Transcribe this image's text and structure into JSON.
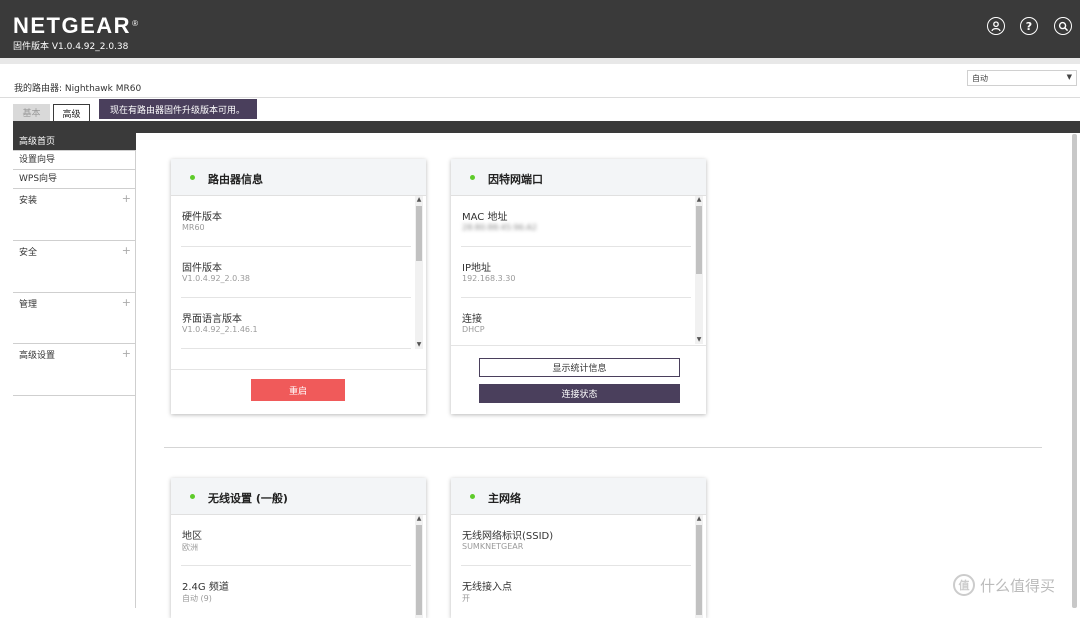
{
  "header": {
    "brand": "NETGEAR",
    "brand_mark": "®",
    "firmware_version": "固件版本 V1.0.4.92_2.0.38",
    "icons": [
      "account-icon",
      "help-icon",
      "search-icon"
    ]
  },
  "top": {
    "my_router": "我的路由器: Nighthawk MR60",
    "language_select": "自动"
  },
  "tabs": {
    "basic": "基本",
    "advanced": "高级"
  },
  "notice": "现在有路由器固件升级版本可用。",
  "sidebar": {
    "items": [
      {
        "label": "高级首页",
        "expandable": false
      },
      {
        "label": "设置向导",
        "expandable": false
      },
      {
        "label": "WPS向导",
        "expandable": false
      },
      {
        "label": "安装",
        "expandable": true
      },
      {
        "label": "安全",
        "expandable": true
      },
      {
        "label": "管理",
        "expandable": true
      },
      {
        "label": "高级设置",
        "expandable": true
      }
    ]
  },
  "cards": {
    "router_info": {
      "title": "路由器信息",
      "rows": [
        {
          "label": "硬件版本",
          "value": "MR60"
        },
        {
          "label": "固件版本",
          "value": "V1.0.4.92_2.0.38"
        },
        {
          "label": "界面语言版本",
          "value": "V1.0.4.92_2.1.46.1"
        }
      ],
      "restart_button": "重启"
    },
    "internet_port": {
      "title": "因特网端口",
      "rows": [
        {
          "label": "MAC 地址",
          "value": "28:80:88:45:96:A2"
        },
        {
          "label": "IP地址",
          "value": "192.168.3.30"
        },
        {
          "label": "连接",
          "value": "DHCP"
        }
      ],
      "stats_button": "显示统计信息",
      "connection_button": "连接状态"
    },
    "wireless": {
      "title": "无线设置 (一般)",
      "rows": [
        {
          "label": "地区",
          "value": "欧洲"
        },
        {
          "label": "2.4G 频道",
          "value": "自动 (9)"
        }
      ]
    },
    "main_network": {
      "title": "主网络",
      "rows": [
        {
          "label": "无线网络标识(SSID)",
          "value": "SUMKNETGEAR"
        },
        {
          "label": "无线接入点",
          "value": "开"
        }
      ]
    }
  },
  "watermark": "什么值得买",
  "watermark_icon": "值",
  "colors": {
    "header_bg": "#3a3a3a",
    "accent_purple": "#4a3f5c",
    "restart_red": "#f05a5a",
    "status_green": "#5ecb2a"
  }
}
